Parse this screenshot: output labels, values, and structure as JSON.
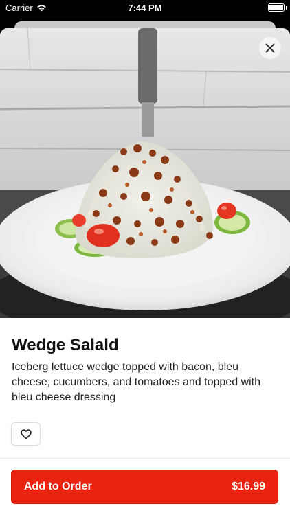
{
  "status_bar": {
    "carrier": "Carrier",
    "time": "7:44 PM"
  },
  "item": {
    "name": "Wedge Salald",
    "description": "Iceberg lettuce wedge topped with bacon, bleu cheese, cucumbers, and tomatoes and topped with bleu cheese dressing"
  },
  "order_button": {
    "label": "Add to Order",
    "price": "$16.99"
  },
  "colors": {
    "accent": "#e8230f"
  },
  "icons": {
    "close": "close-icon",
    "favorite": "heart-icon",
    "wifi": "wifi-icon",
    "battery": "battery-icon"
  }
}
